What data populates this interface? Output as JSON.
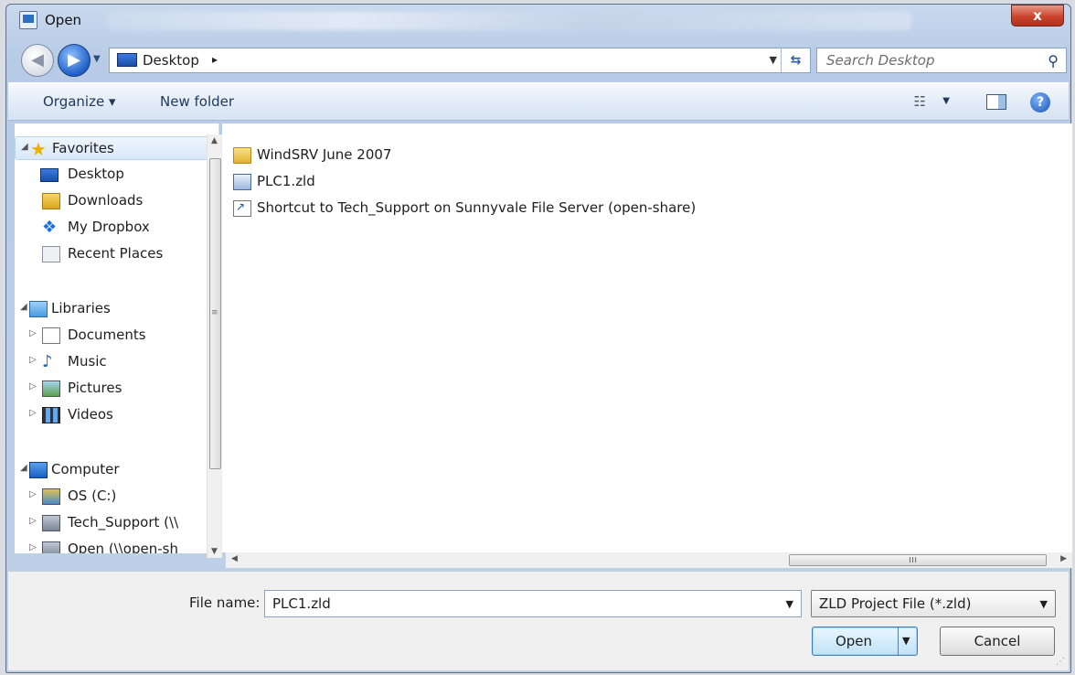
{
  "window": {
    "title": "Open",
    "close_glyph": "x"
  },
  "address": {
    "location": "Desktop",
    "separator": "▸",
    "search_placeholder": "Search Desktop"
  },
  "toolbar": {
    "organize_label": "Organize ▾",
    "new_folder_label": "New folder",
    "help_glyph": "?"
  },
  "navigation": {
    "favorites": {
      "label": "Favorites",
      "items": [
        "Desktop",
        "Downloads",
        "My Dropbox",
        "Recent Places"
      ]
    },
    "libraries": {
      "label": "Libraries",
      "items": [
        "Documents",
        "Music",
        "Pictures",
        "Videos"
      ]
    },
    "computer": {
      "label": "Computer",
      "items": [
        "OS (C:)",
        "Tech_Support (\\\\",
        "Open (\\\\open-sh"
      ]
    }
  },
  "files": [
    {
      "name": "WindSRV June 2007",
      "icon": "folder-icon"
    },
    {
      "name": "PLC1.zld",
      "icon": "zld-file-icon"
    },
    {
      "name": "Shortcut to Tech_Support on Sunnyvale File Server (open-share)",
      "icon": "shortcut-icon"
    }
  ],
  "bottom": {
    "file_name_label": "File name:",
    "file_name_value": "PLC1.zld",
    "file_type_value": "ZLD Project File (*.zld)",
    "open_label": "Open",
    "cancel_label": "Cancel"
  },
  "colors": {
    "accent": "#2f6fc2",
    "close_button": "#c9442c"
  }
}
